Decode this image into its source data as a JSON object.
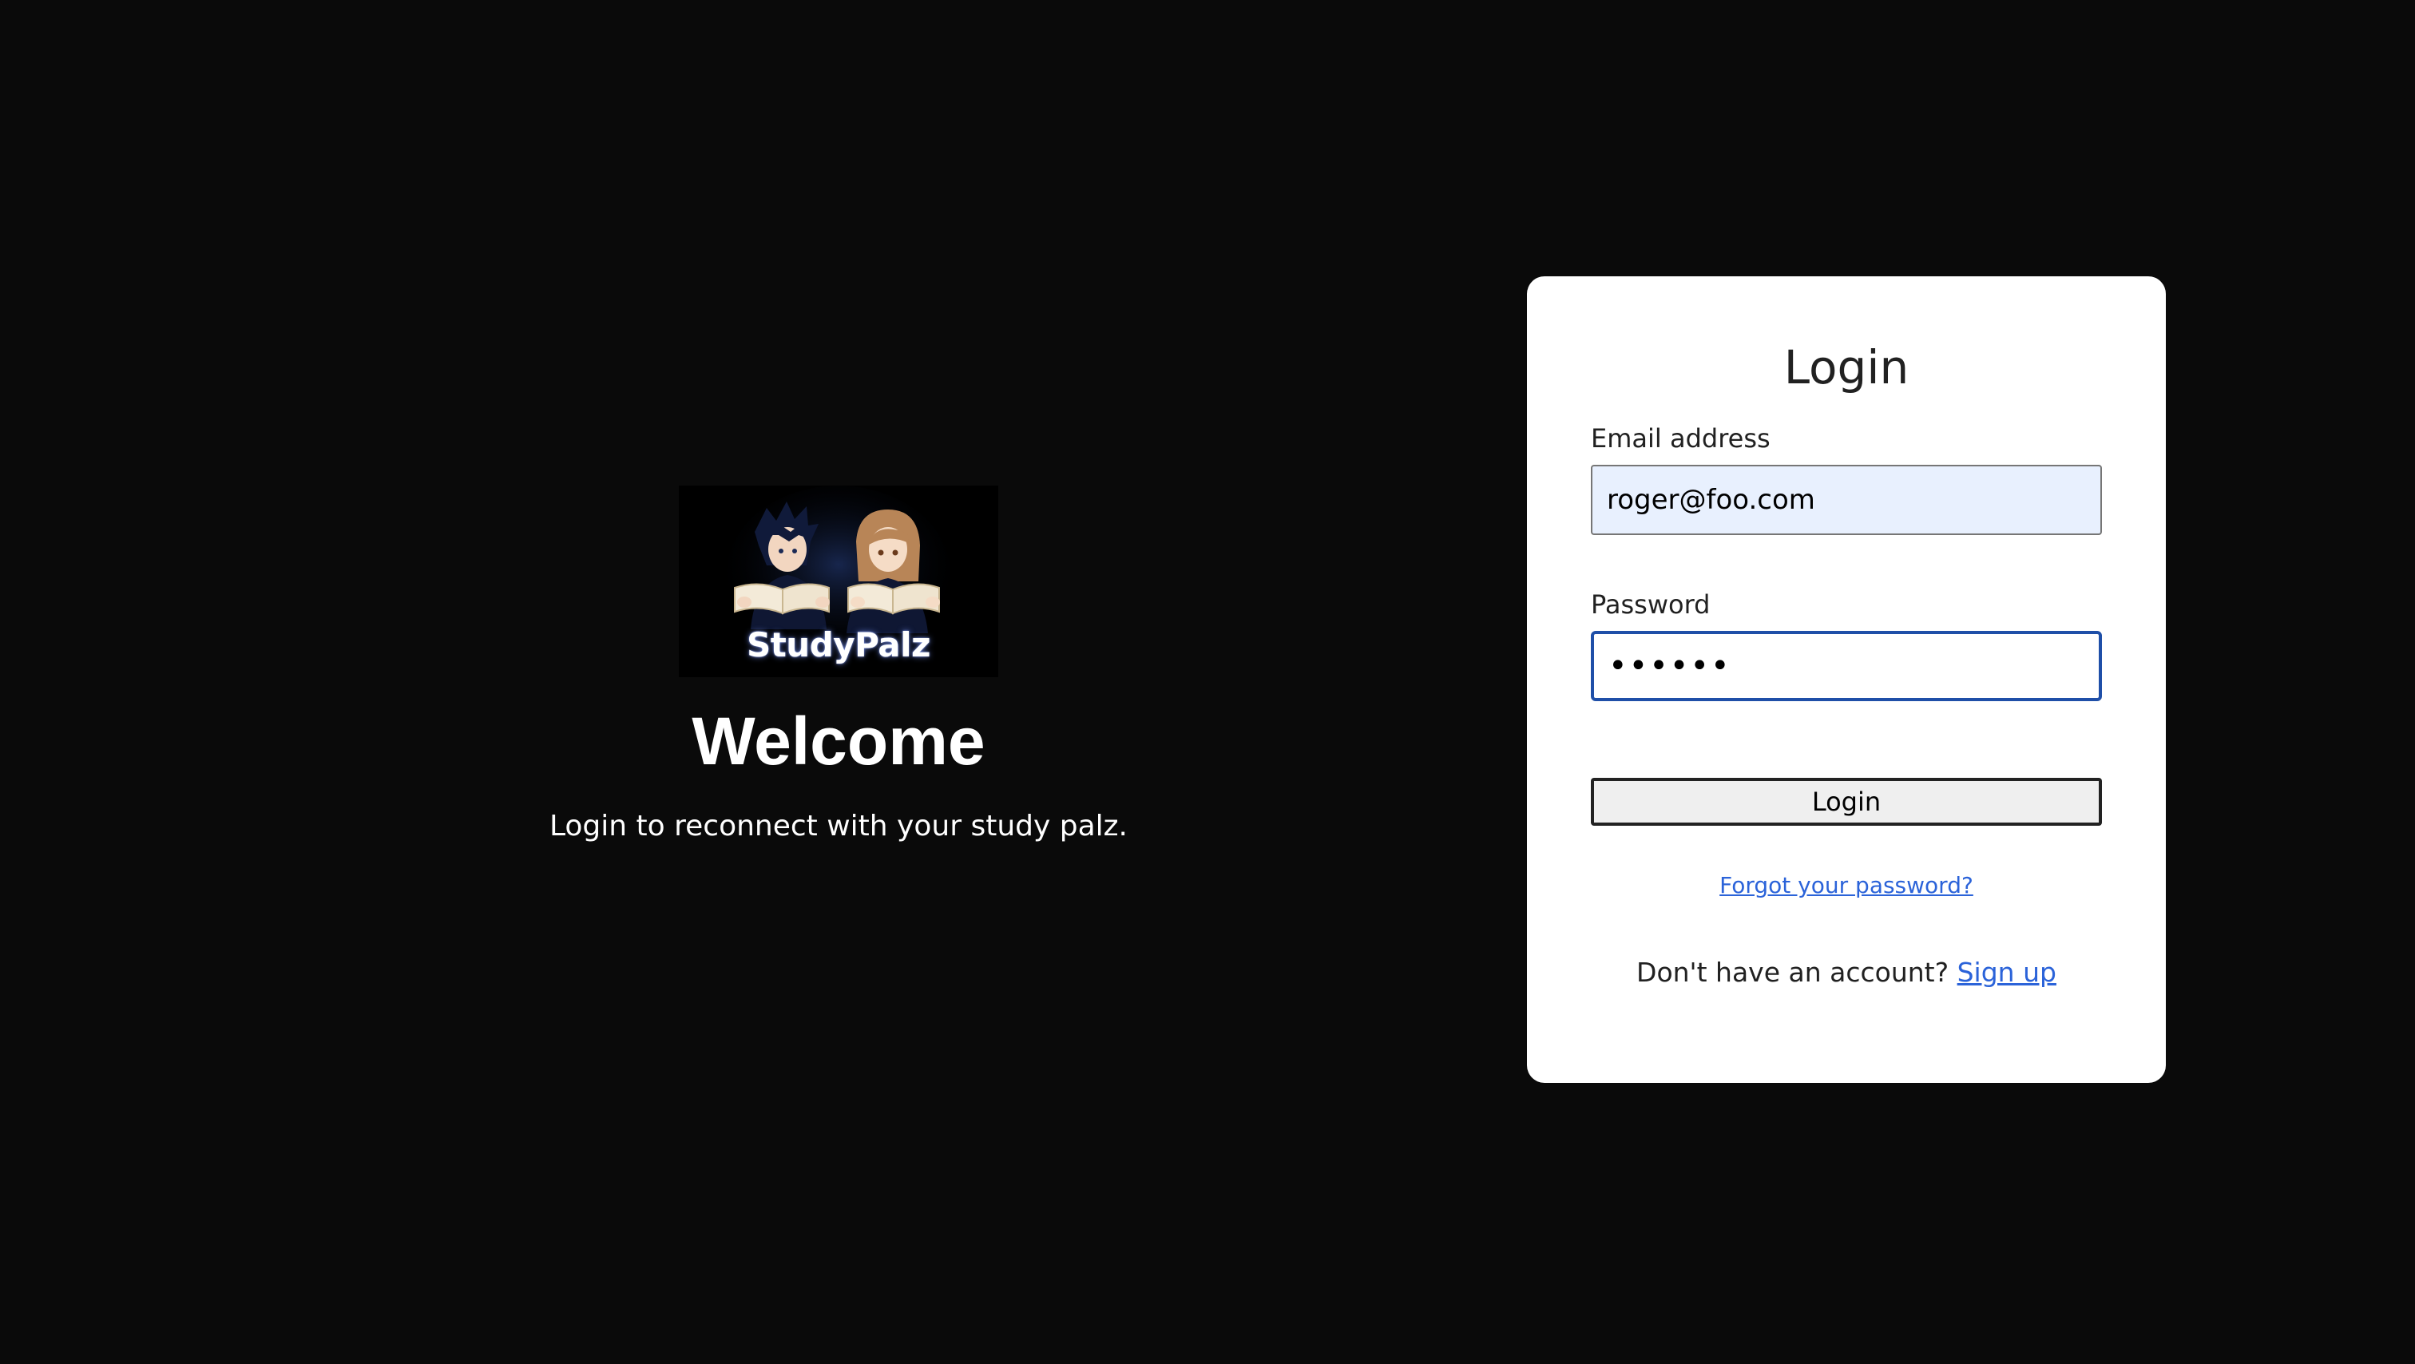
{
  "hero": {
    "logo_text": "StudyPalz",
    "welcome": "Welcome",
    "tagline": "Login to reconnect with your study palz."
  },
  "card": {
    "title": "Login",
    "email_label": "Email address",
    "email_value": "roger@foo.com",
    "password_label": "Password",
    "password_value": "••••••",
    "login_button": "Login",
    "forgot_link": "Forgot your password?",
    "signup_prompt": "Don't have an account?",
    "signup_link": "Sign up"
  },
  "colors": {
    "background": "#0a0a0a",
    "card": "#ffffff",
    "link": "#2b63d9",
    "autofill": "#e8f0fe",
    "focus": "#1f4fa8"
  },
  "icons": {
    "logo": "two-anime-students-reading-books-logo"
  }
}
